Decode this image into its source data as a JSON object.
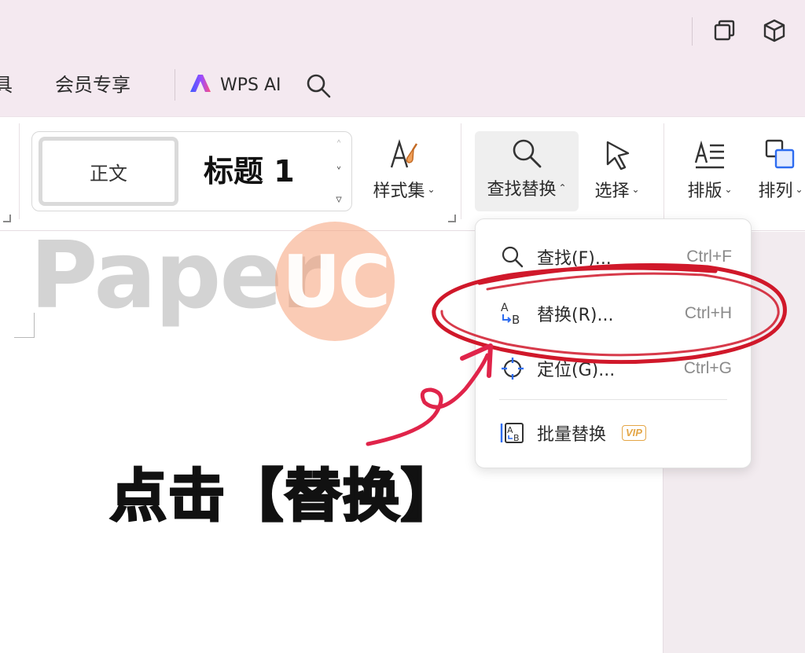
{
  "window": {
    "restore_icon": "restore-window-icon",
    "cube_icon": "cube-icon"
  },
  "tabs": {
    "partial_label": "具",
    "member_label": "会员专享",
    "ai_label": "WPS AI",
    "search_icon": "search-icon"
  },
  "ribbon": {
    "style_gallery": {
      "normal_label": "正文",
      "heading1_label": "标题 1"
    },
    "style_set_label": "样式集",
    "find_replace_label": "查找替换",
    "select_label": "选择",
    "layout_label": "排版",
    "arrange_label": "排列"
  },
  "dropdown": {
    "items": [
      {
        "label": "查找(F)...",
        "shortcut": "Ctrl+F",
        "icon": "search-icon"
      },
      {
        "label": "替换(R)...",
        "shortcut": "Ctrl+H",
        "icon": "replace-icon"
      },
      {
        "label": "定位(G)...",
        "shortcut": "Ctrl+G",
        "icon": "locate-icon"
      },
      {
        "label": "批量替换",
        "badge": "VIP",
        "icon": "batch-replace-icon"
      }
    ]
  },
  "watermark": {
    "text1": "Paper",
    "text2": "UC"
  },
  "annotation": {
    "text": "点击【替换】",
    "highlight_color": "#d0182a"
  }
}
